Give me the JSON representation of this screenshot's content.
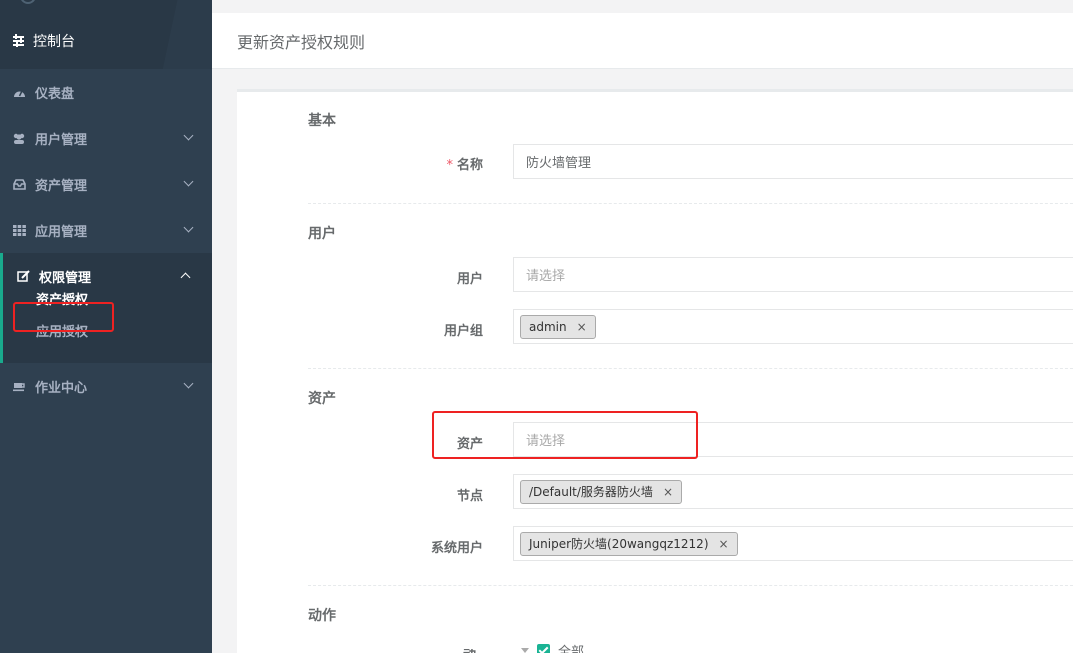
{
  "sidebar": {
    "console_label": "控制台",
    "items": [
      {
        "label": "仪表盘",
        "icon": "tachometer-icon"
      },
      {
        "label": "用户管理",
        "icon": "users-icon"
      },
      {
        "label": "资产管理",
        "icon": "inbox-icon"
      },
      {
        "label": "应用管理",
        "icon": "grid-icon"
      },
      {
        "label": "权限管理",
        "icon": "edit-icon",
        "expanded": true,
        "children": [
          {
            "label": "资产授权",
            "active": true
          },
          {
            "label": "应用授权"
          }
        ]
      },
      {
        "label": "作业中心",
        "icon": "coffee-icon"
      }
    ]
  },
  "header": {
    "title": "更新资产授权规则"
  },
  "form": {
    "sections": {
      "basic": "基本",
      "user": "用户",
      "asset": "资产",
      "action": "动作"
    },
    "name": {
      "label": "名称",
      "required_mark": "*",
      "value": "防火墙管理"
    },
    "users": {
      "label": "用户",
      "placeholder": "请选择"
    },
    "user_groups": {
      "label": "用户组",
      "tags": [
        "admin"
      ]
    },
    "assets": {
      "label": "资产",
      "placeholder": "请选择"
    },
    "nodes": {
      "label": "节点",
      "tags": [
        "/Default/服务器防火墙"
      ]
    },
    "system_users": {
      "label": "系统用户",
      "tags": [
        "Juniper防火墙(20wangqz1212)"
      ]
    },
    "actions": {
      "label": "动作",
      "option_all": "全部",
      "all_checked": true
    },
    "tag_remove_glyph": "×"
  },
  "colors": {
    "sidebar_bg": "#2f4050",
    "sidebar_header_bg": "#293846",
    "accent": "#1ab394",
    "highlight_box": "#ee2222",
    "required": "#ed5565"
  }
}
